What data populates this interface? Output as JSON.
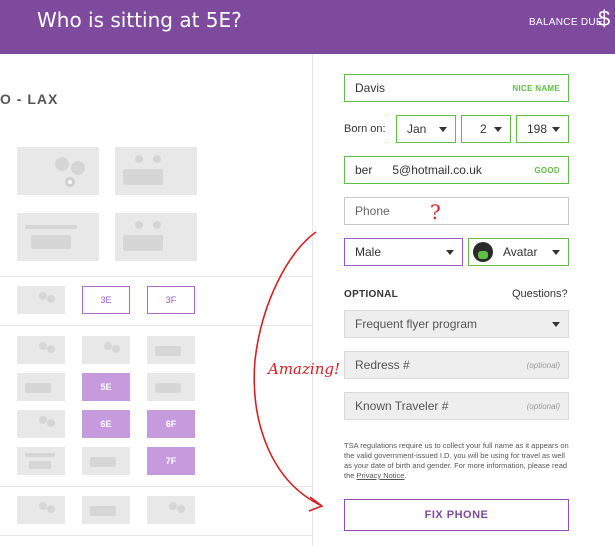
{
  "header": {
    "title": "Who is sitting at 5E?",
    "balance_label": "BALANCE DUE",
    "balance_symbol": "$"
  },
  "seatmap": {
    "route": "O - LAX",
    "seats": {
      "row3": [
        "3E",
        "3F"
      ],
      "row5": "5E",
      "row6": [
        "6E",
        "6F"
      ],
      "row7": "7F"
    }
  },
  "form": {
    "last_name": {
      "value": "Davis",
      "badge": "NICE NAME"
    },
    "born_label": "Born on:",
    "birth_month": "Jan",
    "birth_day": "2",
    "birth_year": "198",
    "email": {
      "value": "ber      5@hotmail.co.uk",
      "badge": "GOOD"
    },
    "phone_placeholder": "Phone",
    "gender": "Male",
    "avatar_label": "Avatar",
    "optional_heading": "OPTIONAL",
    "questions": "Questions?",
    "frequent_flyer": "Frequent flyer program",
    "redress": {
      "placeholder": "Redress #",
      "hint": "(optional)"
    },
    "known_traveler": {
      "placeholder": "Known Traveler #",
      "hint": "(optional)"
    },
    "tsa_text": "TSA regulations require us to collect your full name as it appears on the valid government-issued I.D. you will be using for travel as well as your date of birth and gender. For more information, please read the",
    "privacy_link": "Privacy Notice",
    "tsa_end": ".",
    "fix_button": "FIX PHONE"
  },
  "annotations": {
    "question_mark": "?",
    "amazing": "Amazing!"
  },
  "colors": {
    "header": "#7d4a9e",
    "valid": "#5fbf45",
    "accent": "#9b59c6",
    "annotation": "#d42020"
  }
}
